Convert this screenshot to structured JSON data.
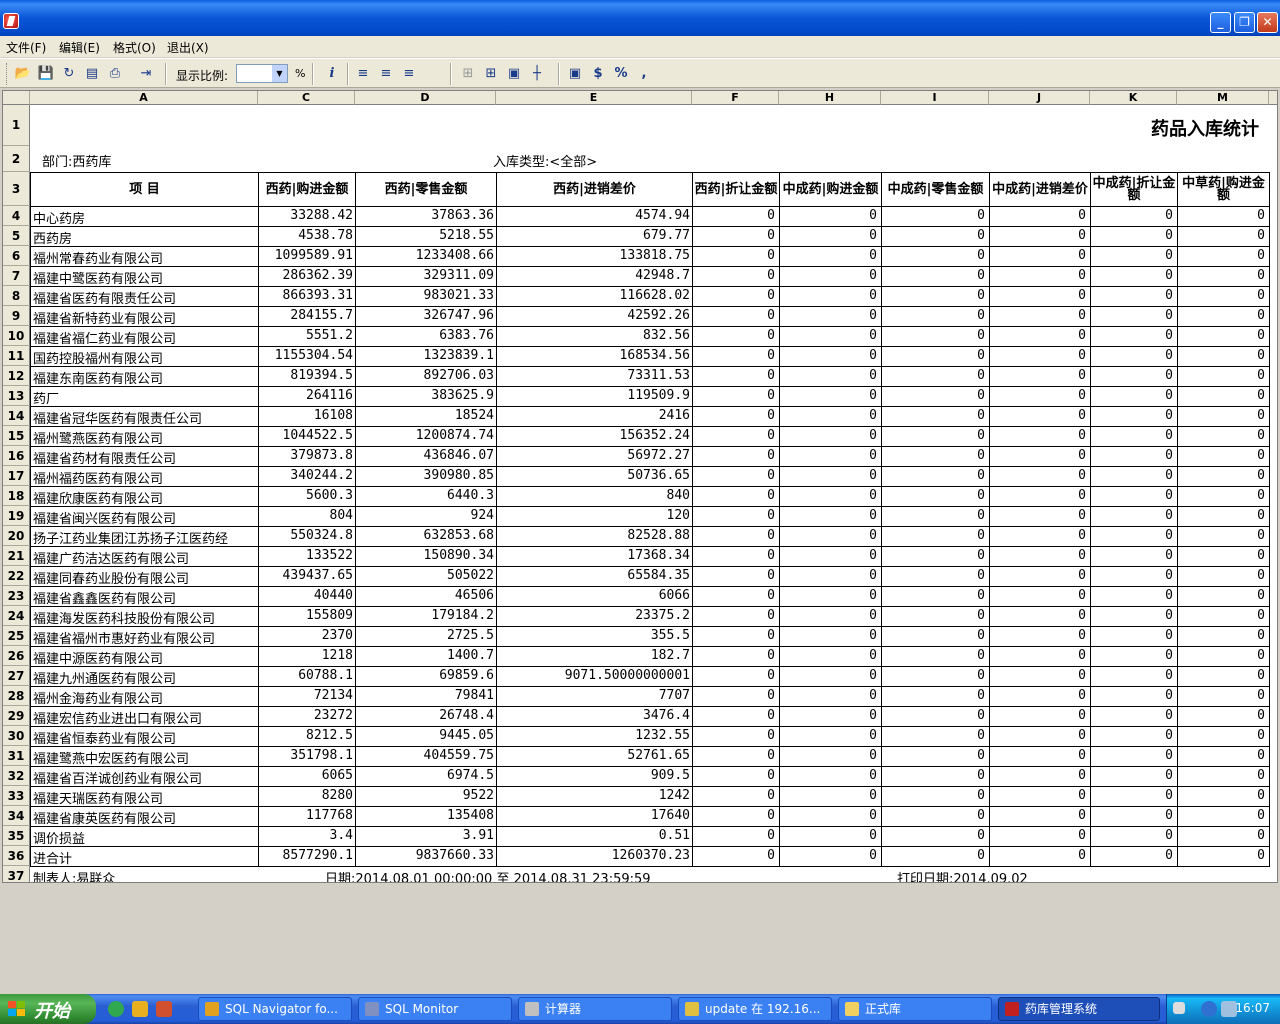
{
  "window": {
    "title": ""
  },
  "menu": [
    "文件(F)",
    "编辑(E)",
    "格式(O)",
    "退出(X)"
  ],
  "toolbar": {
    "zoom_label": "显示比例:",
    "zoom_value": "",
    "zoom_unit": "%"
  },
  "columns": [
    "A",
    "C",
    "D",
    "E",
    "F",
    "H",
    "I",
    "J",
    "K",
    "M"
  ],
  "report": {
    "title": "药品入库统计",
    "dept": "部门:西药库",
    "type": "入库类型:<全部>",
    "headers": [
      "项    目",
      "西药|购进金额",
      "西药|零售金额",
      "西药|进销差价",
      "西药|折让金额",
      "中成药|购进金额",
      "中成药|零售金额",
      "中成药|进销差价",
      "中成药|折让金额",
      "中草药|购进金额"
    ],
    "footer": {
      "maker": "制表人:易联众",
      "date_range": "日期:2014.08.01 00:00:00 至 2014.08.31 23:59:59",
      "print_date": "打印日期:2014.09.02"
    }
  },
  "rows": [
    [
      "中心药房",
      "33288.42",
      "37863.36",
      "4574.94"
    ],
    [
      "西药房",
      "4538.78",
      "5218.55",
      "679.77"
    ],
    [
      "福州常春药业有限公司",
      "1099589.91",
      "1233408.66",
      "133818.75"
    ],
    [
      "福建中鹭医药有限公司",
      "286362.39",
      "329311.09",
      "42948.7"
    ],
    [
      "福建省医药有限责任公司",
      "866393.31",
      "983021.33",
      "116628.02"
    ],
    [
      "福建省新特药业有限公司",
      "284155.7",
      "326747.96",
      "42592.26"
    ],
    [
      "福建省福仁药业有限公司",
      "5551.2",
      "6383.76",
      "832.56"
    ],
    [
      "国药控股福州有限公司",
      "1155304.54",
      "1323839.1",
      "168534.56"
    ],
    [
      "福建东南医药有限公司",
      "819394.5",
      "892706.03",
      "73311.53"
    ],
    [
      "药厂",
      "264116",
      "383625.9",
      "119509.9"
    ],
    [
      "福建省冠华医药有限责任公司",
      "16108",
      "18524",
      "2416"
    ],
    [
      "福州鹭燕医药有限公司",
      "1044522.5",
      "1200874.74",
      "156352.24"
    ],
    [
      "福建省药材有限责任公司",
      "379873.8",
      "436846.07",
      "56972.27"
    ],
    [
      "福州福药医药有限公司",
      "340244.2",
      "390980.85",
      "50736.65"
    ],
    [
      "福建欣康医药有限公司",
      "5600.3",
      "6440.3",
      "840"
    ],
    [
      "福建省闽兴医药有限公司",
      "804",
      "924",
      "120"
    ],
    [
      "扬子江药业集团江苏扬子江医药经",
      "550324.8",
      "632853.68",
      "82528.88"
    ],
    [
      "福建广药洁达医药有限公司",
      "133522",
      "150890.34",
      "17368.34"
    ],
    [
      "福建同春药业股份有限公司",
      "439437.65",
      "505022",
      "65584.35"
    ],
    [
      "福建省鑫鑫医药有限公司",
      "40440",
      "46506",
      "6066"
    ],
    [
      "福建海发医药科技股份有限公司",
      "155809",
      "179184.2",
      "23375.2"
    ],
    [
      "福建省福州市惠好药业有限公司",
      "2370",
      "2725.5",
      "355.5"
    ],
    [
      "福建中源医药有限公司",
      "1218",
      "1400.7",
      "182.7"
    ],
    [
      "福建九州通医药有限公司",
      "60788.1",
      "69859.6",
      "9071.50000000001"
    ],
    [
      "福州金海药业有限公司",
      "72134",
      "79841",
      "7707"
    ],
    [
      "福建宏信药业进出口有限公司",
      "23272",
      "26748.4",
      "3476.4"
    ],
    [
      "福建省恒泰药业有限公司",
      "8212.5",
      "9445.05",
      "1232.55"
    ],
    [
      "福建鹭燕中宏医药有限公司",
      "351798.1",
      "404559.75",
      "52761.65"
    ],
    [
      "福建省百洋诚创药业有限公司",
      "6065",
      "6974.5",
      "909.5"
    ],
    [
      "福建天瑞医药有限公司",
      "8280",
      "9522",
      "1242"
    ],
    [
      "福建省康英医药有限公司",
      "117768",
      "135408",
      "17640"
    ],
    [
      "调价损益",
      "3.4",
      "3.91",
      "0.51"
    ],
    [
      "进合计",
      "8577290.1",
      "9837660.33",
      "1260370.23"
    ]
  ],
  "zero": "0",
  "taskbar": {
    "start": "开始",
    "tasks": [
      "SQL Navigator fo...",
      "SQL Monitor",
      "计算器",
      "update 在 192.16...",
      "正式库",
      "药库管理系统"
    ],
    "clock": "16:07"
  }
}
